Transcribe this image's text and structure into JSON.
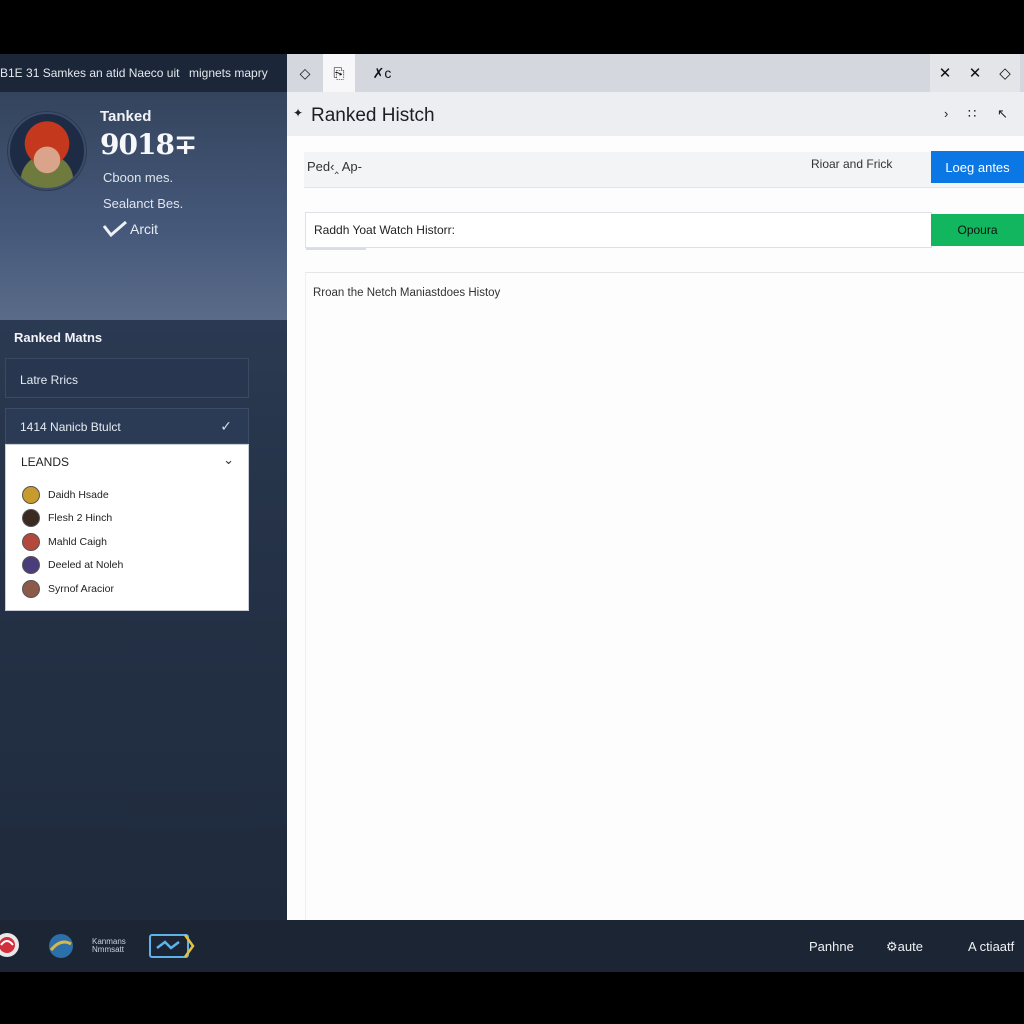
{
  "left_top_bar": {
    "text1": "B1E 31  Samkes an atid Naeco uit",
    "text2": "mignets mapry"
  },
  "profile": {
    "rank_label": "Tanked",
    "rank_value": "9018∓",
    "meta1": "Cboon mes.",
    "meta2": "Sealanct Bes.",
    "badge": "Arcit"
  },
  "sidebar": {
    "section_title": "Ranked Matns",
    "filter_label": "Latre Rrics",
    "select_label": "1414 Nanicb Btulct",
    "dropdown": {
      "title": "LEANDS",
      "items": [
        {
          "label": "Daidh Hsade",
          "color": "#c99a2e"
        },
        {
          "label": "Flesh 2 Hinch",
          "color": "#3a2a22"
        },
        {
          "label": "Mahld Caigh",
          "color": "#b5483c"
        },
        {
          "label": "Deeled at Noleh",
          "color": "#4a3d7a"
        },
        {
          "label": "Syrnof Aracior",
          "color": "#8b5a4a"
        }
      ]
    }
  },
  "tabs": [
    "◇",
    "⎘",
    "✗c"
  ],
  "window_controls": [
    "✕",
    "✕",
    "◇"
  ],
  "main": {
    "title": "Ranked Histch",
    "title_actions": [
      "›",
      "∷",
      "↖"
    ],
    "filter_text": "Ped‹‸ Ap-",
    "filter_right": "Rioar and Frick",
    "blue_button": "Loeg antes",
    "search_text": "Raddh Yoat Watch Historr:",
    "green_button": "Opoura",
    "history_text": "Rroan the Netch Maniastdoes Histoy"
  },
  "footer": {
    "logo_text": "Kanmans Nmmsatt",
    "right1": "Panhne",
    "right2": "aute",
    "right3": "A ctiaatf"
  },
  "colors": {
    "accent_blue": "#0b77e4",
    "accent_green": "#12b65e",
    "sidebar_bg": "#243146"
  }
}
